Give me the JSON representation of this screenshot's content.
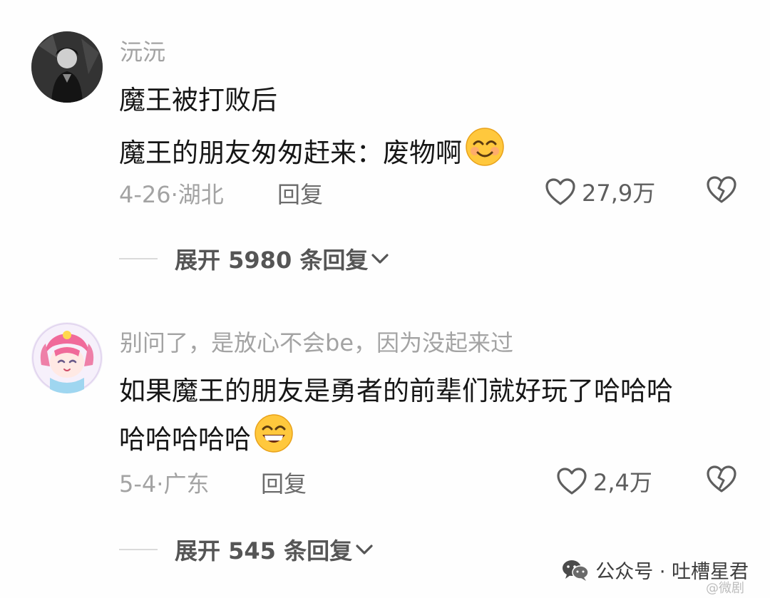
{
  "comments": [
    {
      "username": "沅沅",
      "lines": [
        "魔王被打败后",
        "魔王的朋友匆匆赶来：废物啊"
      ],
      "emoji": "smile-emoji",
      "date": "4-26",
      "location": "湖北",
      "reply_label": "回复",
      "likes": "27,9万",
      "expand_label": "展开 5980 条回复"
    },
    {
      "username": "别问了，是放心不会be，因为没起来过",
      "lines": [
        "如果魔王的朋友是勇者的前辈们就好玩了哈哈哈",
        "哈哈哈哈哈"
      ],
      "emoji": "grin-emoji",
      "date": "5-4",
      "location": "广东",
      "reply_label": "回复",
      "likes": "2,4万",
      "expand_label": "展开 545 条回复"
    }
  ],
  "watermark": {
    "text": "公众号 · 吐槽星君",
    "sub": "@微剧"
  },
  "colors": {
    "username": "#a3a3a3",
    "body_text": "#161616",
    "meta": "#a3a3a3",
    "emoji_face": "#ffc83d"
  }
}
